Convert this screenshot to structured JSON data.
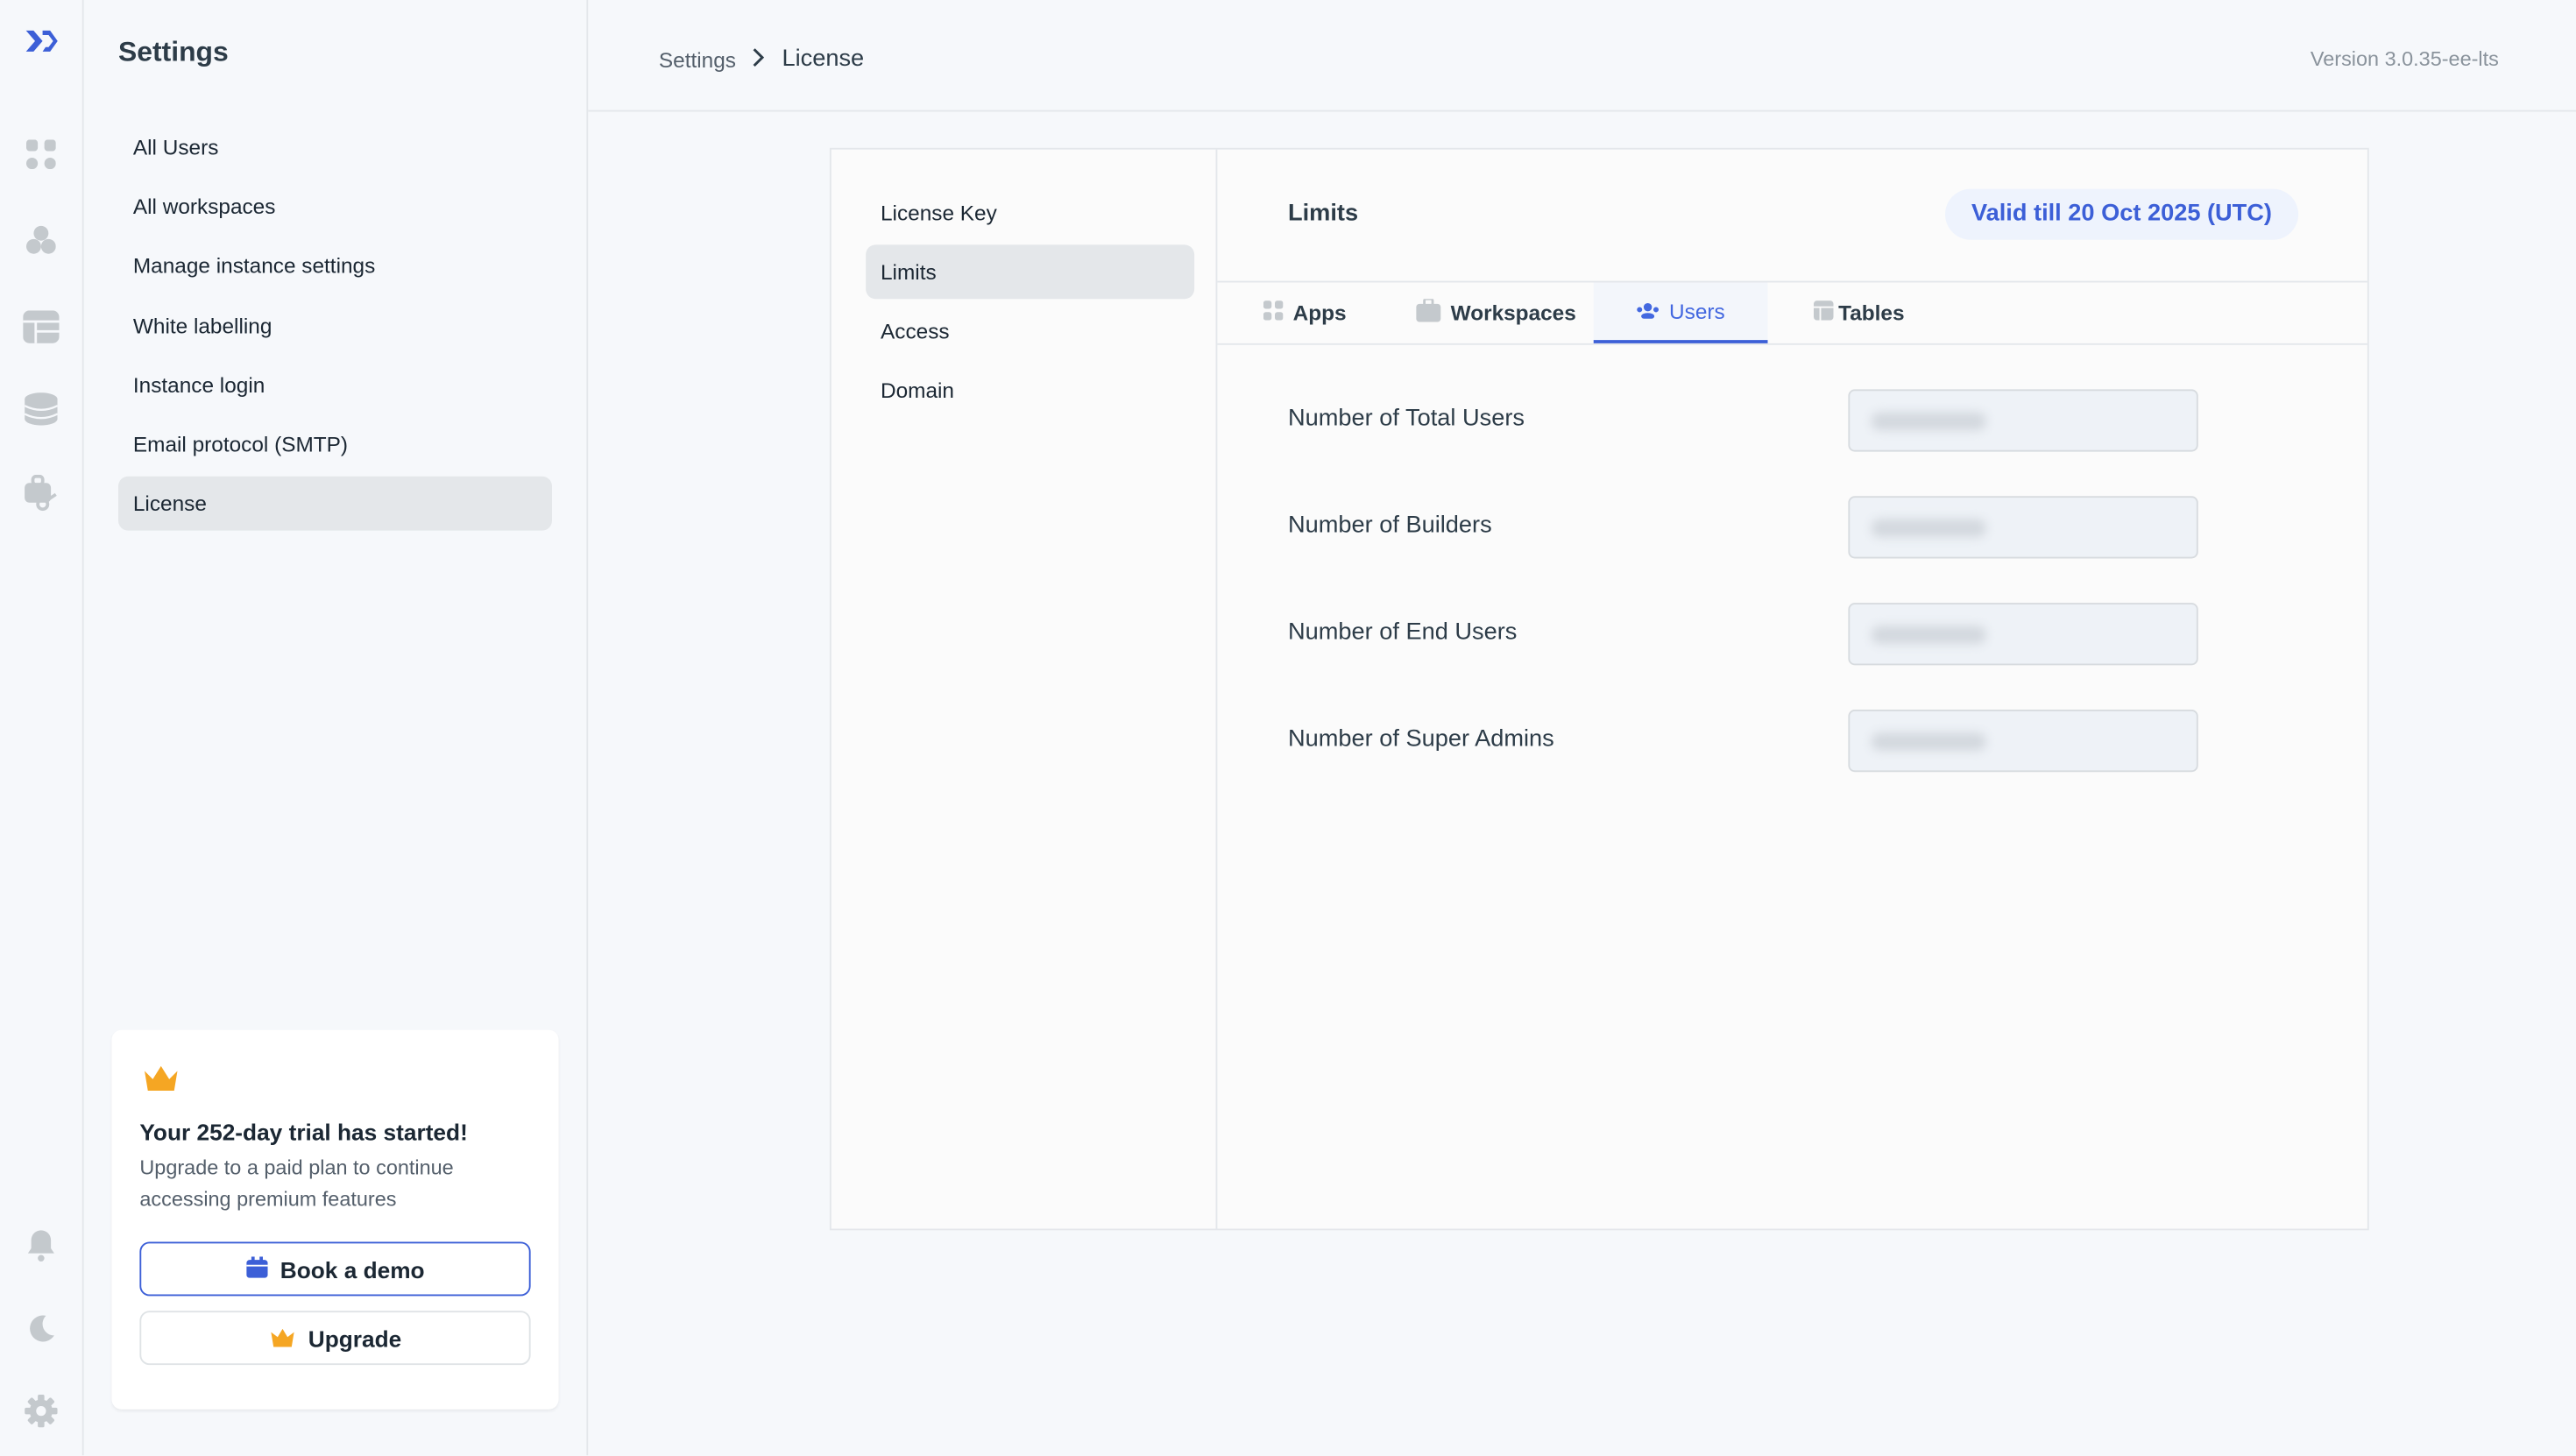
{
  "rail": {
    "icons": [
      "logo-icon",
      "apps-icon",
      "workspaces-icon",
      "tables-icon",
      "database-icon",
      "workflows-icon",
      "bell-icon",
      "moon-icon",
      "gear-icon"
    ]
  },
  "sidebar": {
    "title": "Settings",
    "items": [
      {
        "label": "All Users"
      },
      {
        "label": "All workspaces"
      },
      {
        "label": "Manage instance settings"
      },
      {
        "label": "White labelling"
      },
      {
        "label": "Instance login"
      },
      {
        "label": "Email protocol (SMTP)"
      },
      {
        "label": "License",
        "active": true
      }
    ],
    "trial": {
      "title": "Your 252-day trial has started!",
      "text": "Upgrade to a paid plan to continue accessing premium features",
      "book_demo": "Book a demo",
      "upgrade": "Upgrade"
    }
  },
  "header": {
    "breadcrumb": [
      "Settings",
      "License"
    ],
    "version": "Version 3.0.35-ee-lts"
  },
  "license_nav": {
    "items": [
      {
        "label": "License Key"
      },
      {
        "label": "Limits",
        "active": true
      },
      {
        "label": "Access"
      },
      {
        "label": "Domain"
      }
    ]
  },
  "limits": {
    "title": "Limits",
    "validity": "Valid till 20 Oct 2025 (UTC)",
    "tabs": [
      {
        "label": "Apps"
      },
      {
        "label": "Workspaces"
      },
      {
        "label": "Users",
        "active": true
      },
      {
        "label": "Tables"
      }
    ],
    "rows": [
      {
        "label": "Number of Total Users"
      },
      {
        "label": "Number of Builders"
      },
      {
        "label": "Number of End Users"
      },
      {
        "label": "Number of Super Admins"
      }
    ]
  },
  "colors": {
    "accent": "#3c5fd7",
    "crown": "#f5a623",
    "active_bg": "#e4e7ea"
  }
}
